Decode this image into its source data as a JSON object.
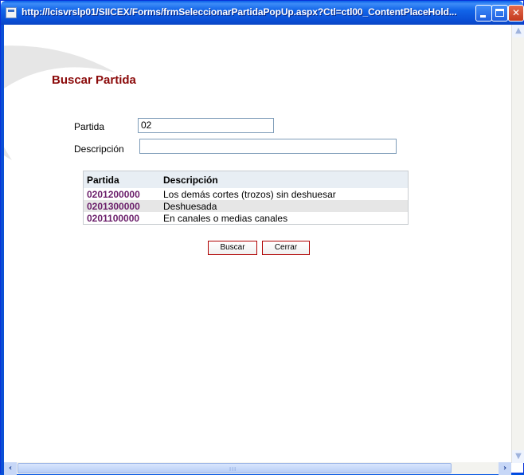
{
  "window": {
    "title": "http://lcisvrslp01/SIICEX/Forms/frmSeleccionarPartidaPopUp.aspx?Ctl=ctl00_ContentPlaceHold...",
    "controls": {
      "minimize": "minimize",
      "maximize": "maximize",
      "close": "close"
    }
  },
  "form": {
    "heading": "Buscar Partida",
    "partida_label": "Partida",
    "partida_value": "02",
    "descripcion_label": "Descripción",
    "descripcion_value": ""
  },
  "results": {
    "columns": [
      "Partida",
      "Descripción"
    ],
    "rows": [
      {
        "code": "0201200000",
        "description": "Los demás cortes (trozos) sin deshuesar"
      },
      {
        "code": "0201300000",
        "description": "Deshuesada"
      },
      {
        "code": "0201100000",
        "description": "En canales o medias canales"
      }
    ]
  },
  "buttons": {
    "buscar": "Buscar",
    "cerrar": "Cerrar"
  },
  "scrollbar": {
    "grip": "III"
  },
  "colors": {
    "heading": "#8b0a0a",
    "code_link": "#6b1f6b",
    "titlebar": "#0a4fd6",
    "button_border": "#b00000"
  }
}
